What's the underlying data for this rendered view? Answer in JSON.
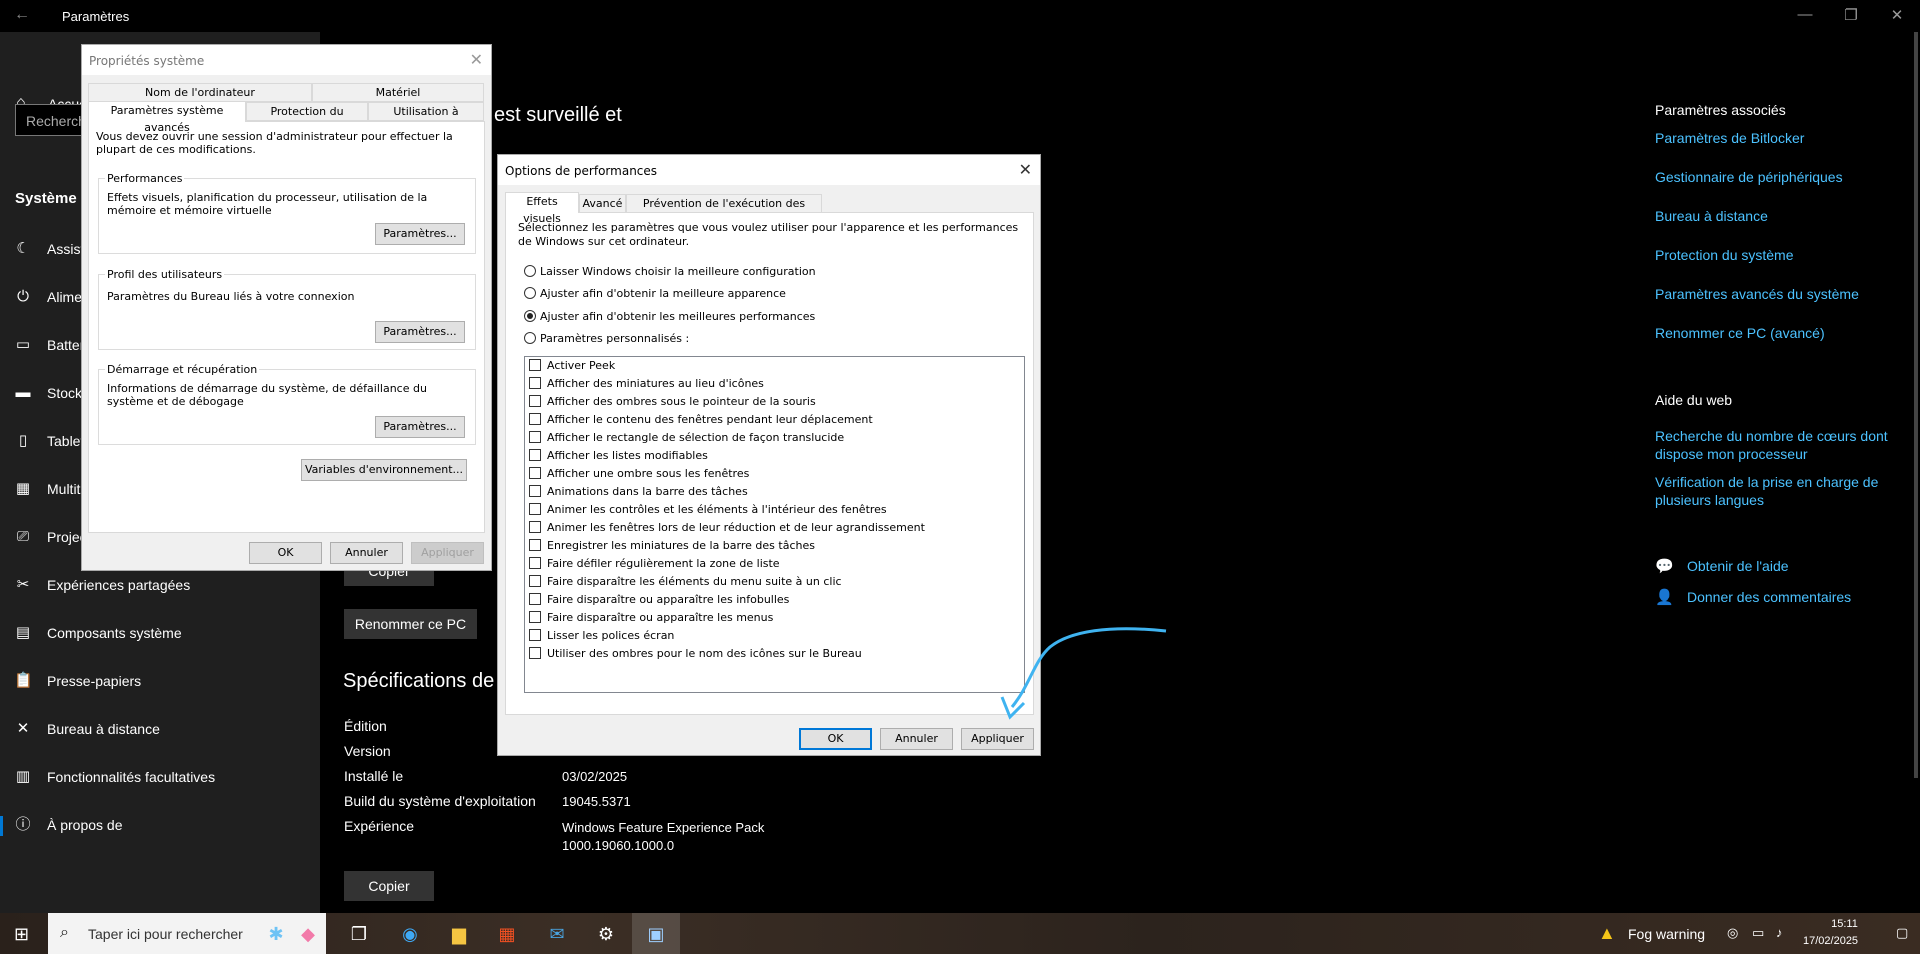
{
  "window": {
    "title": "Paramètres",
    "back_icon": "back-arrow-icon",
    "minimize": "—",
    "maximize": "❐",
    "close": "✕"
  },
  "sidebar": {
    "home_label": "Accueil",
    "search_placeholder": "Rechercher",
    "section": "Système",
    "items": [
      {
        "label": "Assistant de concentration",
        "icon": "moon-icon"
      },
      {
        "label": "Alimentation et mise en veille",
        "icon": "power-icon"
      },
      {
        "label": "Batterie",
        "icon": "battery-icon"
      },
      {
        "label": "Stockage",
        "icon": "storage-icon"
      },
      {
        "label": "Tablette",
        "icon": "tablet-icon"
      },
      {
        "label": "Multitâche",
        "icon": "multitask-icon"
      },
      {
        "label": "Projection sur ce PC",
        "icon": "projector-icon"
      },
      {
        "label": "Expériences partagées",
        "icon": "shared-icon"
      },
      {
        "label": "Composants système",
        "icon": "components-icon"
      },
      {
        "label": "Presse-papiers",
        "icon": "clipboard-icon"
      },
      {
        "label": "Bureau à distance",
        "icon": "remote-icon"
      },
      {
        "label": "Fonctionnalités facultatives",
        "icon": "features-icon"
      },
      {
        "label": "À propos de",
        "icon": "info-icon"
      }
    ]
  },
  "main": {
    "heading_fragment": "est surveillé et",
    "copy_button_top": "Copier",
    "rename_button": "Renommer ce PC",
    "specs_heading": "Spécifications de",
    "specs": [
      {
        "label": "Édition",
        "value": ""
      },
      {
        "label": "Version",
        "value": ""
      },
      {
        "label": "Installé le",
        "value": "03/02/2025"
      },
      {
        "label": "Build du système d'exploitation",
        "value": "19045.5371"
      },
      {
        "label": "Expérience",
        "value": "Windows Feature Experience Pack",
        "value2": "1000.19060.1000.0"
      }
    ],
    "copy_button_bottom": "Copier"
  },
  "right_panel": {
    "assoc_header": "Paramètres associés",
    "assoc_links": [
      "Paramètres de Bitlocker",
      "Gestionnaire de périphériques",
      "Bureau à distance",
      "Protection du système",
      "Paramètres avancés du système",
      "Renommer ce PC (avancé)"
    ],
    "web_header": "Aide du web",
    "web_links": [
      "Recherche du nombre de cœurs dont dispose mon processeur",
      "Vérification de la prise en charge de plusieurs langues"
    ],
    "help_link": "Obtenir de l'aide",
    "feedback_link": "Donner des commentaires"
  },
  "sys_props": {
    "title": "Propriétés système",
    "tabs_row1": [
      "Nom de l'ordinateur",
      "Matériel"
    ],
    "tabs_row2": [
      "Paramètres système avancés",
      "Protection du système",
      "Utilisation à distance"
    ],
    "admin_note": "Vous devez ouvrir une session d'administrateur pour effectuer la plupart de ces modifications.",
    "perf_title": "Performances",
    "perf_desc": "Effets visuels, planification du processeur, utilisation de la mémoire et mémoire virtuelle",
    "profile_title": "Profil des utilisateurs",
    "profile_desc": "Paramètres du Bureau liés à votre connexion",
    "startup_title": "Démarrage et récupération",
    "startup_desc": "Informations de démarrage du système, de défaillance du système et de débogage",
    "settings_btn": "Paramètres...",
    "env_btn": "Variables d'environnement...",
    "ok": "OK",
    "cancel": "Annuler",
    "apply": "Appliquer"
  },
  "perf_options": {
    "title": "Options de performances",
    "tabs": [
      "Effets visuels",
      "Avancé",
      "Prévention de l'exécution des données"
    ],
    "intro": "Sélectionnez les paramètres que vous voulez utiliser pour l'apparence et les performances de Windows sur cet ordinateur.",
    "radios": [
      {
        "label": "Laisser Windows choisir la meilleure configuration",
        "checked": false
      },
      {
        "label": "Ajuster afin d'obtenir la meilleure apparence",
        "checked": false
      },
      {
        "label": "Ajuster afin d'obtenir les meilleures performances",
        "checked": true
      },
      {
        "label": "Paramètres personnalisés :",
        "checked": false
      }
    ],
    "checkboxes": [
      "Activer Peek",
      "Afficher des miniatures au lieu d'icônes",
      "Afficher des ombres sous le pointeur de la souris",
      "Afficher le contenu des fenêtres pendant leur déplacement",
      "Afficher le rectangle de sélection de façon translucide",
      "Afficher les listes modifiables",
      "Afficher une ombre sous les fenêtres",
      "Animations dans la barre des tâches",
      "Animer les contrôles et les éléments à l'intérieur des fenêtres",
      "Animer les fenêtres lors de leur réduction et de leur agrandissement",
      "Enregistrer les miniatures de la barre des tâches",
      "Faire défiler régulièrement la zone de liste",
      "Faire disparaître les éléments du menu suite à un clic",
      "Faire disparaître ou apparaître les infobulles",
      "Faire disparaître ou apparaître les menus",
      "Lisser les polices écran",
      "Utiliser des ombres pour le nom des icônes sur le Bureau"
    ],
    "ok": "OK",
    "cancel": "Annuler",
    "apply": "Appliquer"
  },
  "taskbar": {
    "search_placeholder": "Taper ici pour rechercher",
    "weather": "Fog warning",
    "time": "15:11",
    "date": "17/02/2025"
  },
  "colors": {
    "accent": "#4cc2ff",
    "sidebar_bg": "#1f1f1f",
    "annotation_arrow": "#3fb3f0"
  }
}
